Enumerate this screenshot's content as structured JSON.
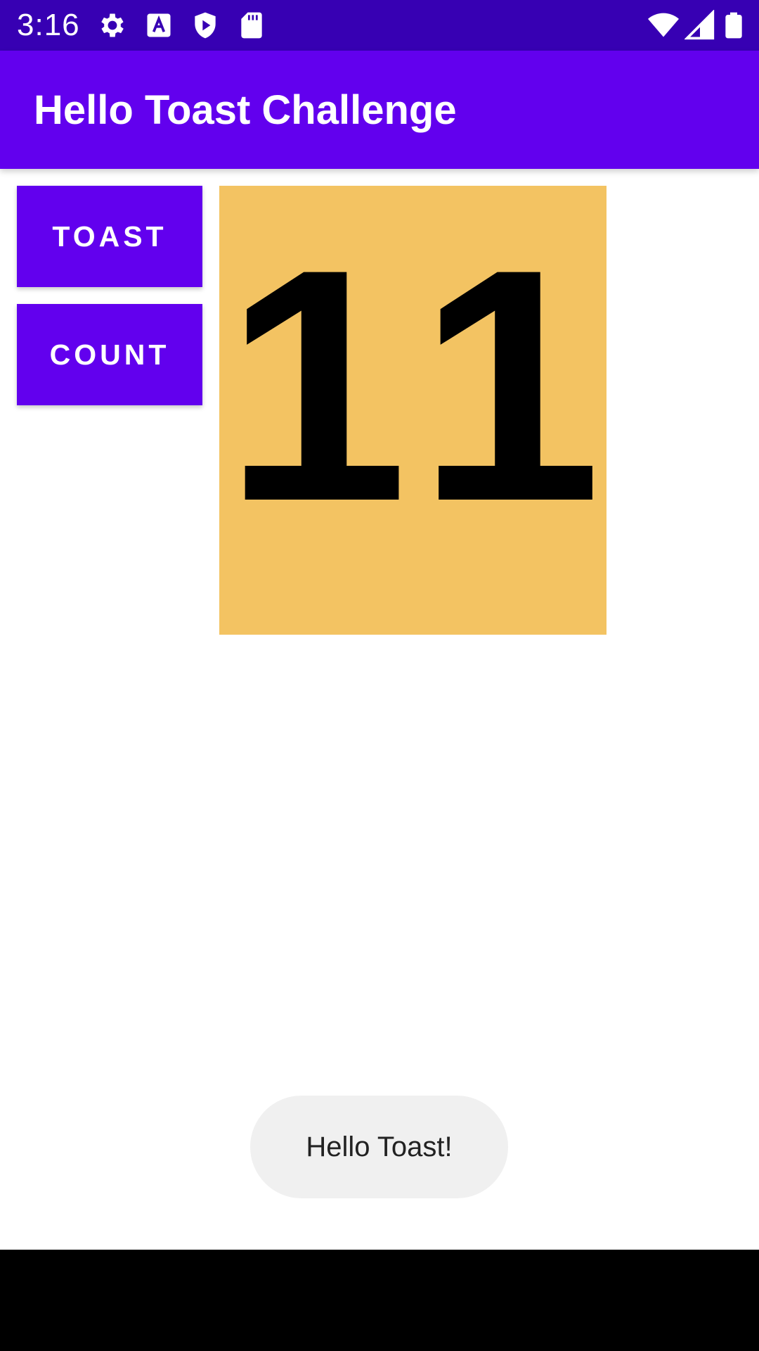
{
  "status_bar": {
    "time": "3:16",
    "left_icons": [
      "gear-icon",
      "keyboard-a-icon",
      "shield-play-icon",
      "sd-card-icon"
    ],
    "right_icons": [
      "wifi-icon",
      "signal-icon",
      "battery-icon"
    ],
    "background": "#3700B3"
  },
  "app_bar": {
    "title": "Hello Toast Challenge",
    "background": "#6200EE"
  },
  "buttons": {
    "toast_label": "TOAST",
    "count_label": "COUNT"
  },
  "counter": {
    "value": "11",
    "background": "#F3C362"
  },
  "toast": {
    "message": "Hello Toast!"
  }
}
